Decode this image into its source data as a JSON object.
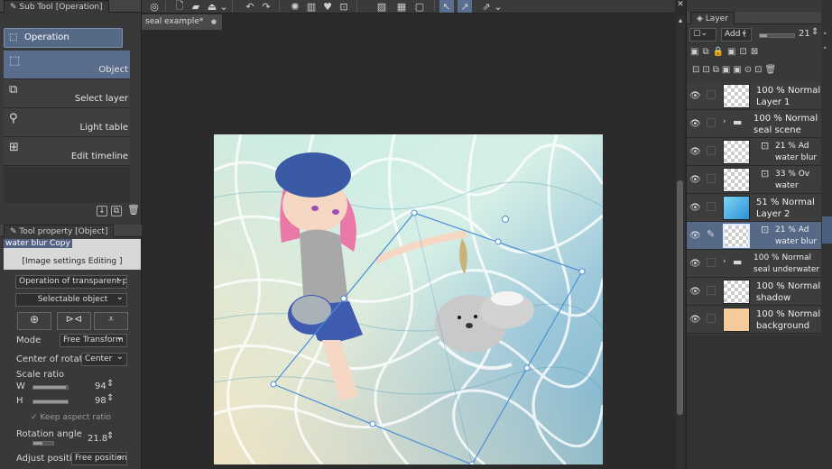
{
  "document_tab": {
    "label": "seal example*",
    "close": "●"
  },
  "left": {
    "subtool_tab": "Sub Tool [Operation]",
    "operation_group": "Operation",
    "tools": [
      {
        "label": "Object"
      },
      {
        "label": "Select layer"
      },
      {
        "label": "Light table"
      },
      {
        "label": "Edit timeline"
      }
    ],
    "toolprop_tab": "Tool property [Object]",
    "layer_name": "water blur Copy",
    "image_settings": "[Image settings Editing ]",
    "transparent_op": "Operation of transparent part",
    "selectable": "Selectable object",
    "mode_label": "Mode",
    "mode_value": "Free Transform",
    "rotation_center_label": "Center of rotation",
    "rotation_center_value": "Center",
    "scale_ratio": "Scale ratio",
    "w_label": "W",
    "w_value": "94",
    "h_label": "H",
    "h_value": "98",
    "keep_aspect": "Keep aspect ratio",
    "rotation_label": "Rotation angle",
    "rotation_value": "21.8",
    "adjust_label": "Adjust position",
    "adjust_value": "Free position"
  },
  "right": {
    "layer_tab": "Layer",
    "blend_value": "Add (",
    "opacity_value": "21",
    "layers": [
      {
        "line1": "100 % Normal",
        "line2": "Layer 1"
      },
      {
        "line1": "100 % Normal",
        "line2": "seal scene"
      },
      {
        "line1": "21 % Ad",
        "line2": "water blur"
      },
      {
        "line1": "33 % Ov",
        "line2": "water"
      },
      {
        "line1": "51 % Normal",
        "line2": "Layer 2"
      },
      {
        "line1": "21 % Ad",
        "line2": "water blur"
      },
      {
        "line1": "100 % Normal",
        "line2": "seal underwater"
      },
      {
        "line1": "100 % Normal",
        "line2": "shadow"
      },
      {
        "line1": "100 % Normal",
        "line2": "background"
      }
    ]
  },
  "colors": {
    "accent": "#566a88",
    "panel": "#393939",
    "transform_box": "#4a8fd8"
  }
}
